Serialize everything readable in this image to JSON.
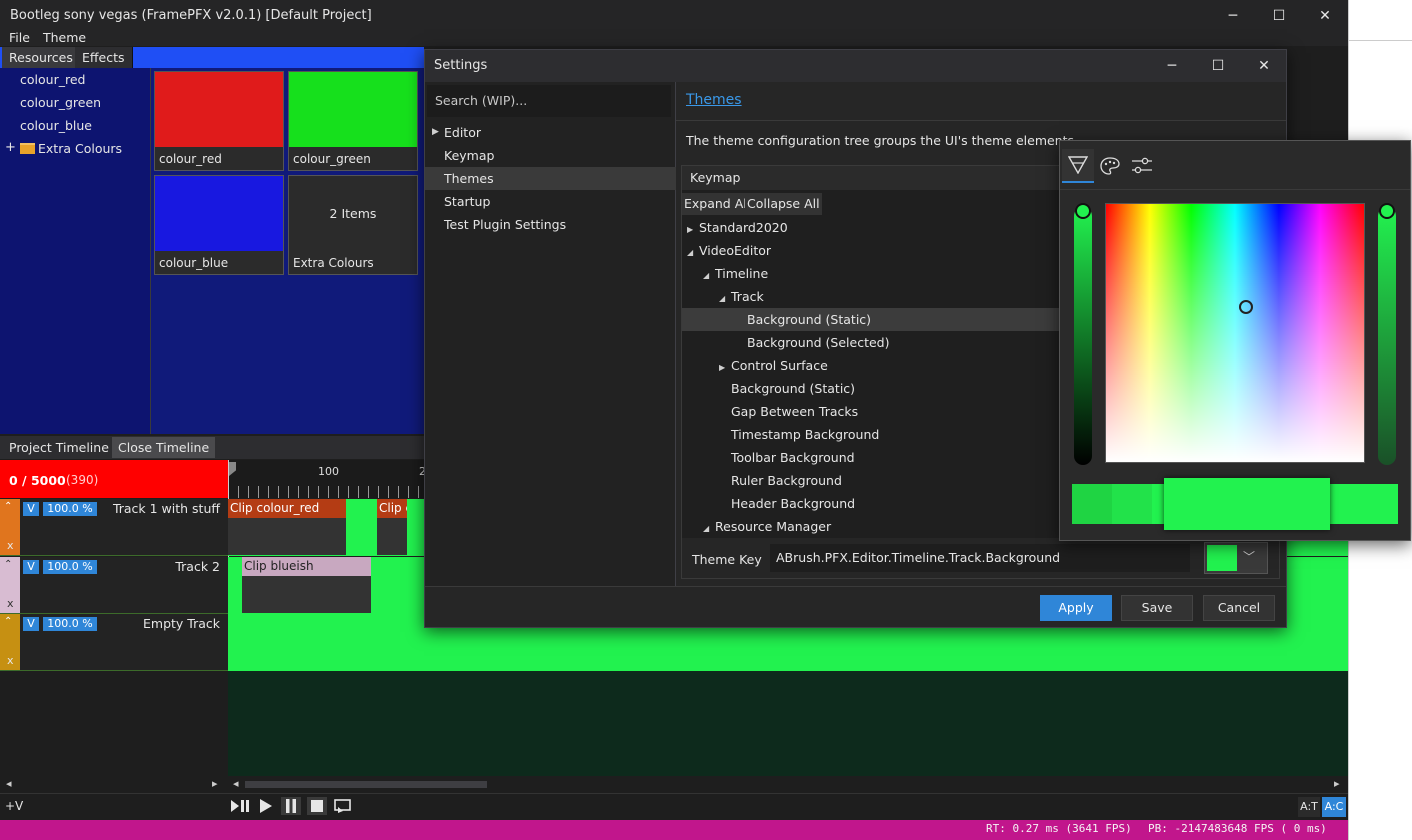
{
  "window": {
    "title": "Bootleg sony vegas (FramePFX v2.0.1) [Default Project]",
    "minimize_glyph": "─",
    "maximize_glyph": "☐",
    "close_glyph": "✕"
  },
  "menu": {
    "items": [
      "File",
      "Theme"
    ]
  },
  "resources": {
    "tabs": [
      "Resources",
      "Effects"
    ],
    "list": [
      "colour_red",
      "colour_green",
      "colour_blue",
      "Extra Colours"
    ],
    "expander_glyph": "+",
    "tiles": [
      {
        "label": "colour_red",
        "color": "#e01b1b"
      },
      {
        "label": "colour_green",
        "color": "#16e01c"
      },
      {
        "label": "colour_blue",
        "color": "#1818e0"
      },
      {
        "label": "Extra Colours",
        "center_text": "2 Items"
      }
    ]
  },
  "timeline": {
    "tabs": [
      "Project Timeline",
      "Close Timeline"
    ],
    "counter": "0 / 5000",
    "counter_extra": "(390)",
    "ruler_labels": [
      "100",
      "2"
    ],
    "tracks": [
      {
        "name": "Track 1 with stuff",
        "visible_label": "V",
        "opacity": "100.0 %",
        "close": "x",
        "color": "#e0751e"
      },
      {
        "name": "Track 2",
        "visible_label": "V",
        "opacity": "100.0 %",
        "close": "x",
        "color": "#d8bcd2"
      },
      {
        "name": "Empty Track",
        "visible_label": "V",
        "opacity": "100.0 %",
        "close": "x",
        "color": "#c69012"
      }
    ],
    "clips": [
      {
        "label": "Clip colour_red",
        "header_color": "#b43c14"
      },
      {
        "label": "Clip c",
        "header_color": "#b43c14"
      },
      {
        "label": "Clip blueish",
        "header_color": "#c8a8c0"
      }
    ],
    "lane_color": "#22f24f",
    "scroll_left": "◂",
    "scroll_right": "▸",
    "add_video_track": "+V",
    "transport_icons": [
      "play-pause-icon",
      "play-icon",
      "pause-icon",
      "stop-icon",
      "loop-icon"
    ],
    "auto_toggles": [
      "A:T",
      "A:C"
    ]
  },
  "status": {
    "rt": "RT:  0.27 ms (3641 FPS)",
    "pb": "PB: -2147483648 FPS (    0 ms)"
  },
  "settings": {
    "title": "Settings",
    "search_placeholder": "Search (WIP)...",
    "nav": [
      {
        "label": "Editor",
        "expandable": true
      },
      {
        "label": "Keymap",
        "expandable": false
      },
      {
        "label": "Themes",
        "expandable": false,
        "selected": true
      },
      {
        "label": "Startup",
        "expandable": false
      },
      {
        "label": "Test Plugin Settings",
        "expandable": false
      }
    ],
    "page_title": "Themes",
    "page_description": "The theme configuration tree groups the UI's theme elements",
    "tree_header": "Keymap",
    "expand_all": "Expand All",
    "collapse_all": "Collapse All",
    "tree": [
      {
        "label": "Standard2020",
        "depth": 0,
        "state": "collapsed"
      },
      {
        "label": "VideoEditor",
        "depth": 0,
        "state": "expanded"
      },
      {
        "label": "Timeline",
        "depth": 1,
        "state": "expanded"
      },
      {
        "label": "Track",
        "depth": 2,
        "state": "expanded"
      },
      {
        "label": "Background (Static)",
        "depth": 3,
        "state": "leaf",
        "selected": true
      },
      {
        "label": "Background (Selected)",
        "depth": 3,
        "state": "leaf"
      },
      {
        "label": "Control Surface",
        "depth": 2,
        "state": "collapsed"
      },
      {
        "label": "Background (Static)",
        "depth": 2,
        "state": "leaf"
      },
      {
        "label": "Gap Between Tracks",
        "depth": 2,
        "state": "leaf"
      },
      {
        "label": "Timestamp Background",
        "depth": 2,
        "state": "leaf"
      },
      {
        "label": "Toolbar Background",
        "depth": 2,
        "state": "leaf"
      },
      {
        "label": "Ruler Background",
        "depth": 2,
        "state": "leaf"
      },
      {
        "label": "Header Background",
        "depth": 2,
        "state": "leaf"
      },
      {
        "label": "Resource Manager",
        "depth": 1,
        "state": "expanded"
      }
    ],
    "theme_key_label": "Theme Key",
    "theme_key_value": "ABrush.PFX.Editor.Timeline.Track.Background",
    "theme_key_color": "#22f24f",
    "buttons": {
      "apply": "Apply",
      "save": "Save",
      "cancel": "Cancel"
    }
  },
  "color_picker": {
    "tabs": [
      "spectrum-icon",
      "palette-icon",
      "sliders-icon"
    ],
    "active_tab": "spectrum-icon",
    "current_color": "#22f24f",
    "history": [
      "#1fd443",
      "#22e24a",
      "#22f24f",
      "#22f24f",
      "#22f24f"
    ]
  }
}
